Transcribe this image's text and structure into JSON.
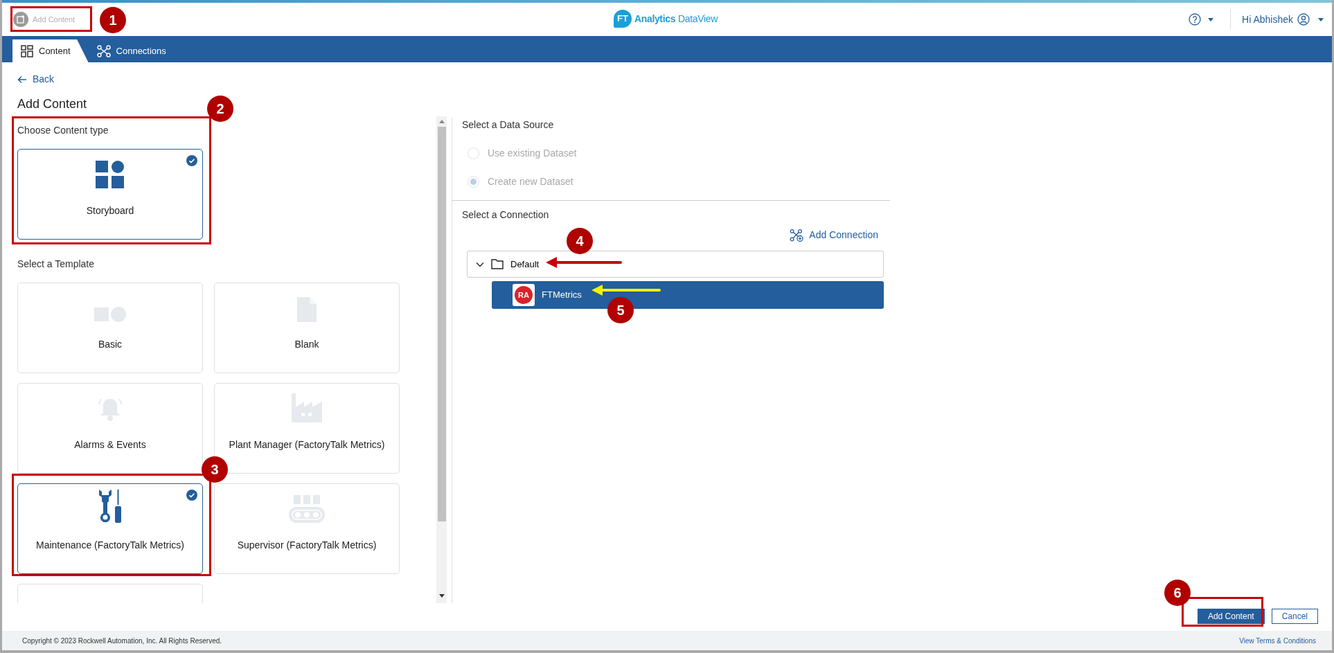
{
  "header": {
    "add_content_button": "Add Content",
    "logo": {
      "mark": "FT",
      "name": "Analytics",
      "suffix": "DataView"
    },
    "user_greeting": "Hi Abhishek"
  },
  "nav_tabs": [
    {
      "label": "Content",
      "kind": "grid",
      "selected": true
    },
    {
      "label": "Connections",
      "kind": "network",
      "selected": false
    }
  ],
  "back_link": "Back",
  "title": "Add Content",
  "content_type": {
    "heading": "Choose Content type",
    "cards": [
      {
        "label": "Storyboard",
        "kind": "storyboard",
        "selected": true
      }
    ]
  },
  "templates": {
    "heading": "Select a Template",
    "more_below": true,
    "cards": [
      {
        "label": "Basic",
        "kind": "basic",
        "selected": false
      },
      {
        "label": "Blank",
        "kind": "blank",
        "selected": false
      },
      {
        "label": "Alarms & Events",
        "kind": "alarm",
        "selected": false
      },
      {
        "label": "Plant Manager (FactoryTalk Metrics)",
        "kind": "factory",
        "selected": false
      },
      {
        "label": "Maintenance (FactoryTalk Metrics)",
        "kind": "tools",
        "selected": true
      },
      {
        "label": "Supervisor (FactoryTalk Metrics)",
        "kind": "conveyor",
        "selected": false
      }
    ]
  },
  "data_source": {
    "heading": "Select a Data Source",
    "options": [
      {
        "label": "Use existing Dataset",
        "selected": false,
        "disabled": true
      },
      {
        "label": "Create new Dataset",
        "selected": true,
        "disabled": true
      }
    ]
  },
  "connections": {
    "heading": "Select a Connection",
    "add_button": "Add Connection",
    "tree": [
      {
        "label": "Default",
        "expanded": true,
        "children": [
          {
            "label": "FTMetrics",
            "logo": "RA",
            "selected": true
          }
        ]
      }
    ]
  },
  "actions": [
    {
      "label": "Add Content",
      "kind": "primary"
    },
    {
      "label": "Cancel",
      "kind": "secondary"
    }
  ],
  "footer": {
    "copyright": "Copyright © 2023 Rockwell Automation, Inc. All Rights Reserved.",
    "terms_link": "View Terms & Conditions"
  },
  "annotations": [
    {
      "label": "1"
    },
    {
      "label": "2"
    },
    {
      "label": "3"
    },
    {
      "label": "4"
    },
    {
      "label": "5"
    },
    {
      "label": "6"
    }
  ]
}
